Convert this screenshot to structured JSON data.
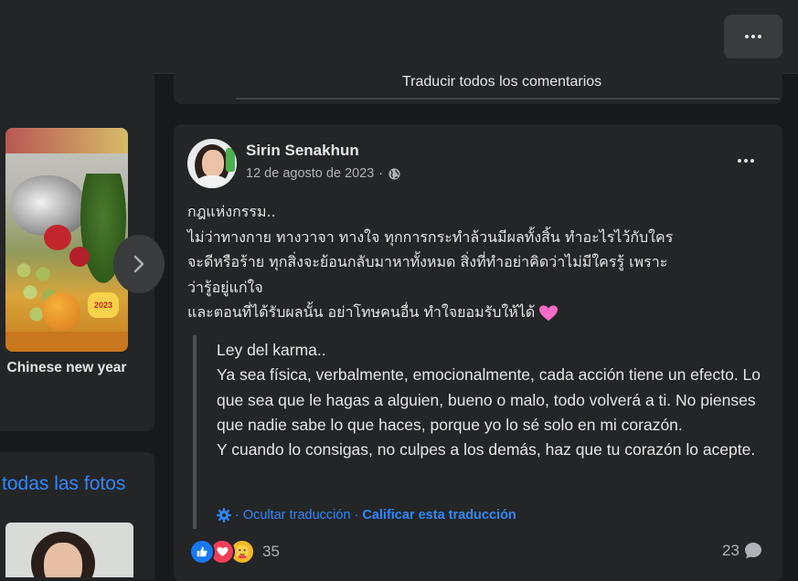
{
  "header": {
    "more_icon": "more-horizontal-icon"
  },
  "left_column": {
    "album": {
      "caption": "Chinese new year",
      "sticker_text": "2023",
      "next_icon": "chevron-right-icon"
    },
    "photos": {
      "link_label": "todas las fotos"
    }
  },
  "upper_card": {
    "translate_all_label": "Traducir todos los comentarios"
  },
  "post": {
    "author": "Sirin Senakhun",
    "date": "12 de agosto de 2023",
    "meta_separator": "·",
    "privacy_icon": "globe-icon",
    "more_icon": "more-horizontal-icon",
    "original_lines": [
      "กฎแห่งกรรม..",
      "ไม่ว่าทางกาย ทางวาจา ทางใจ ทุกการกระทำล้วนมีผลทั้งสิ้น ทำอะไรไว้กับใคร",
      "จะดีหรือร้าย ทุกสิ่งจะย้อนกลับมาหาทั้งหมด สิ่งที่ทำอย่าคิดว่าไม่มีใครรู้ เพราะ",
      "ว่ารู้อยู่แก่ใจ",
      "และตอนที่ได้รับผลนั้น อย่าโทษคนอื่น ทำใจยอมรับให้ได้"
    ],
    "emoji_icon": "pink-heart-emoji",
    "translation_paragraphs": [
      "Ley del karma..",
      "Ya sea física, verbalmente, emocionalmente, cada acción tiene un efecto. Lo que sea que le hagas a alguien, bueno o malo, todo volverá a ti. No pienses que nadie sabe lo que haces, porque yo lo sé solo en mi corazón.",
      "Y cuando lo consigas, no culpes a los demás, haz que tu corazón lo acepte."
    ],
    "translation_settings_icon": "gear-icon",
    "hide_translation_label": "Ocultar traducción",
    "rate_translation_label": "Calificar esta traducción",
    "link_separator": "·",
    "reactions": {
      "icons": [
        "like-icon",
        "love-icon",
        "care-icon"
      ],
      "count": "35"
    },
    "comments": {
      "count": "23",
      "icon": "comment-bubble-icon"
    }
  },
  "colors": {
    "background": "#18191a",
    "card": "#242526",
    "primary_text": "#e4e6eb",
    "secondary_text": "#b0b3b8",
    "link": "#2d88ff",
    "like": "#1877f2",
    "love": "#f33e58"
  }
}
